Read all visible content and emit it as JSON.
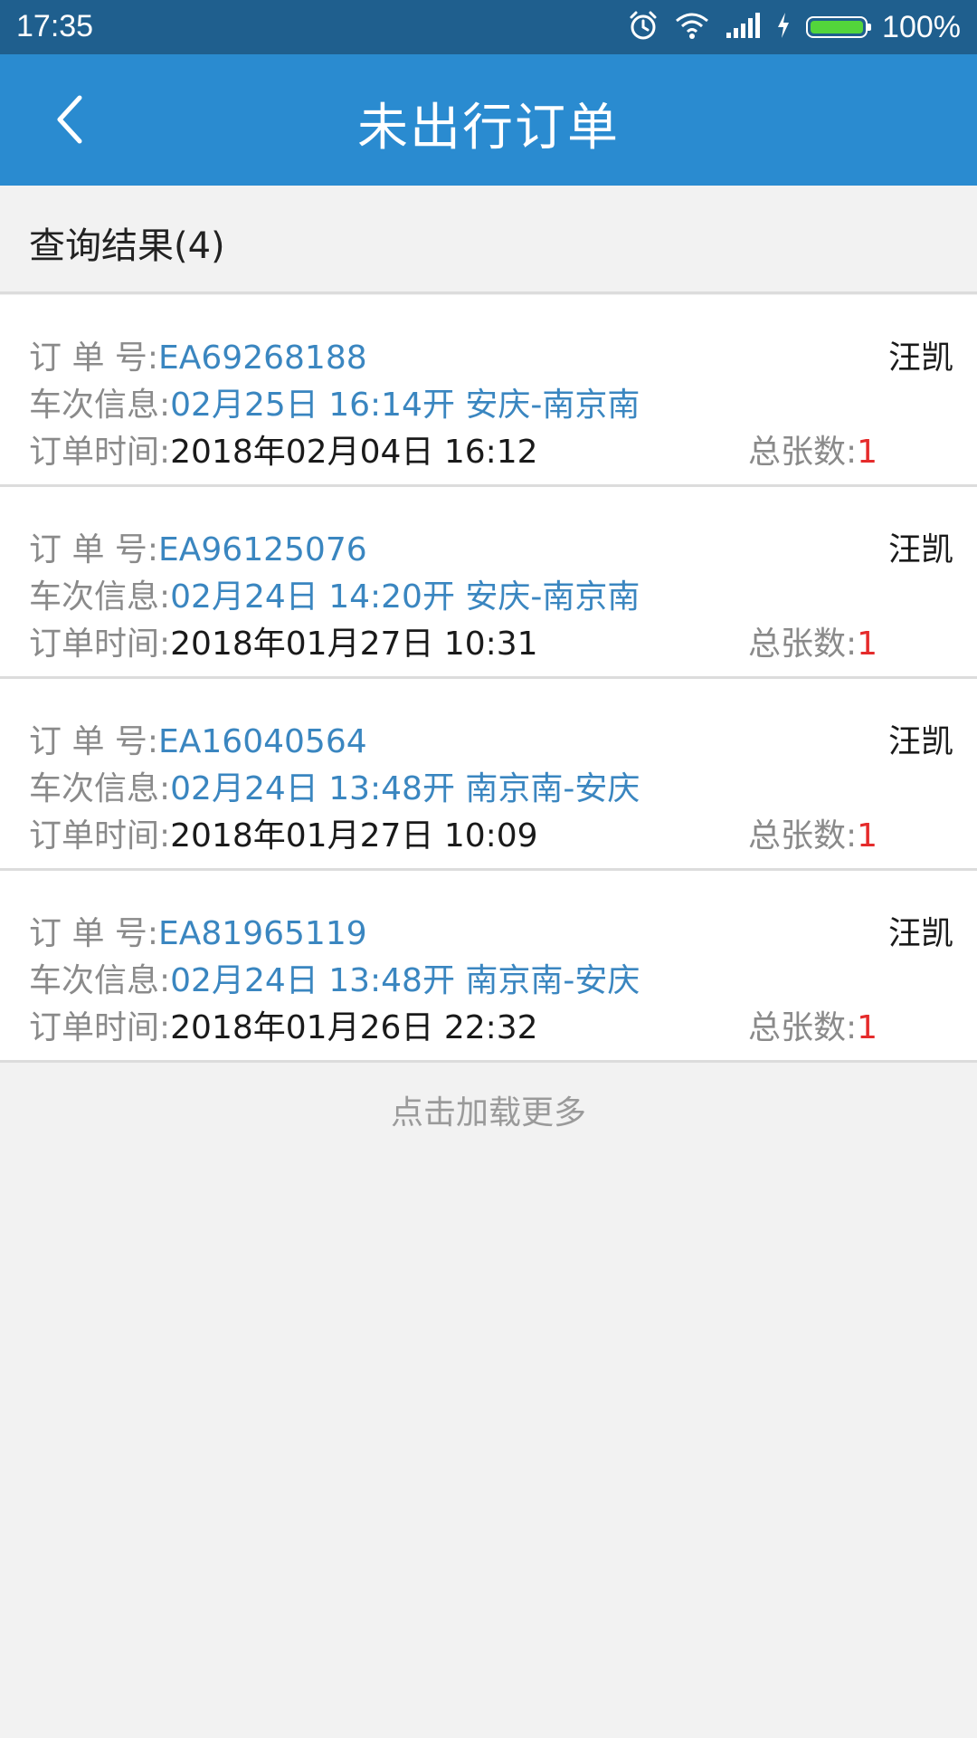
{
  "status": {
    "time": "17:35",
    "battery_pct": "100%",
    "battery_level": 1.0,
    "battery_color": "#53d53b"
  },
  "appbar": {
    "title": "未出行订单"
  },
  "result": {
    "label": "查询结果(4)"
  },
  "labels": {
    "order_no": "订 单 号:",
    "train": "车次信息:",
    "order_time": "订单时间:",
    "count": "总张数:"
  },
  "orders": [
    {
      "order_no": "EA69268188",
      "train": "02月25日 16:14开 安庆-南京南",
      "time": "2018年02月04日 16:12",
      "name": "汪凯",
      "count": "1"
    },
    {
      "order_no": "EA96125076",
      "train": "02月24日 14:20开 安庆-南京南",
      "time": "2018年01月27日 10:31",
      "name": "汪凯",
      "count": "1"
    },
    {
      "order_no": "EA16040564",
      "train": "02月24日 13:48开 南京南-安庆",
      "time": "2018年01月27日 10:09",
      "name": "汪凯",
      "count": "1"
    },
    {
      "order_no": "EA81965119",
      "train": "02月24日 13:48开 南京南-安庆",
      "time": "2018年01月26日 22:32",
      "name": "汪凯",
      "count": "1"
    }
  ],
  "footer": {
    "load_more": "点击加载更多"
  },
  "colors": {
    "appbar": "#2a8bd0",
    "statusbar": "#1f5f8e",
    "link_blue": "#3a86c0",
    "count_red": "#e52b2b"
  }
}
